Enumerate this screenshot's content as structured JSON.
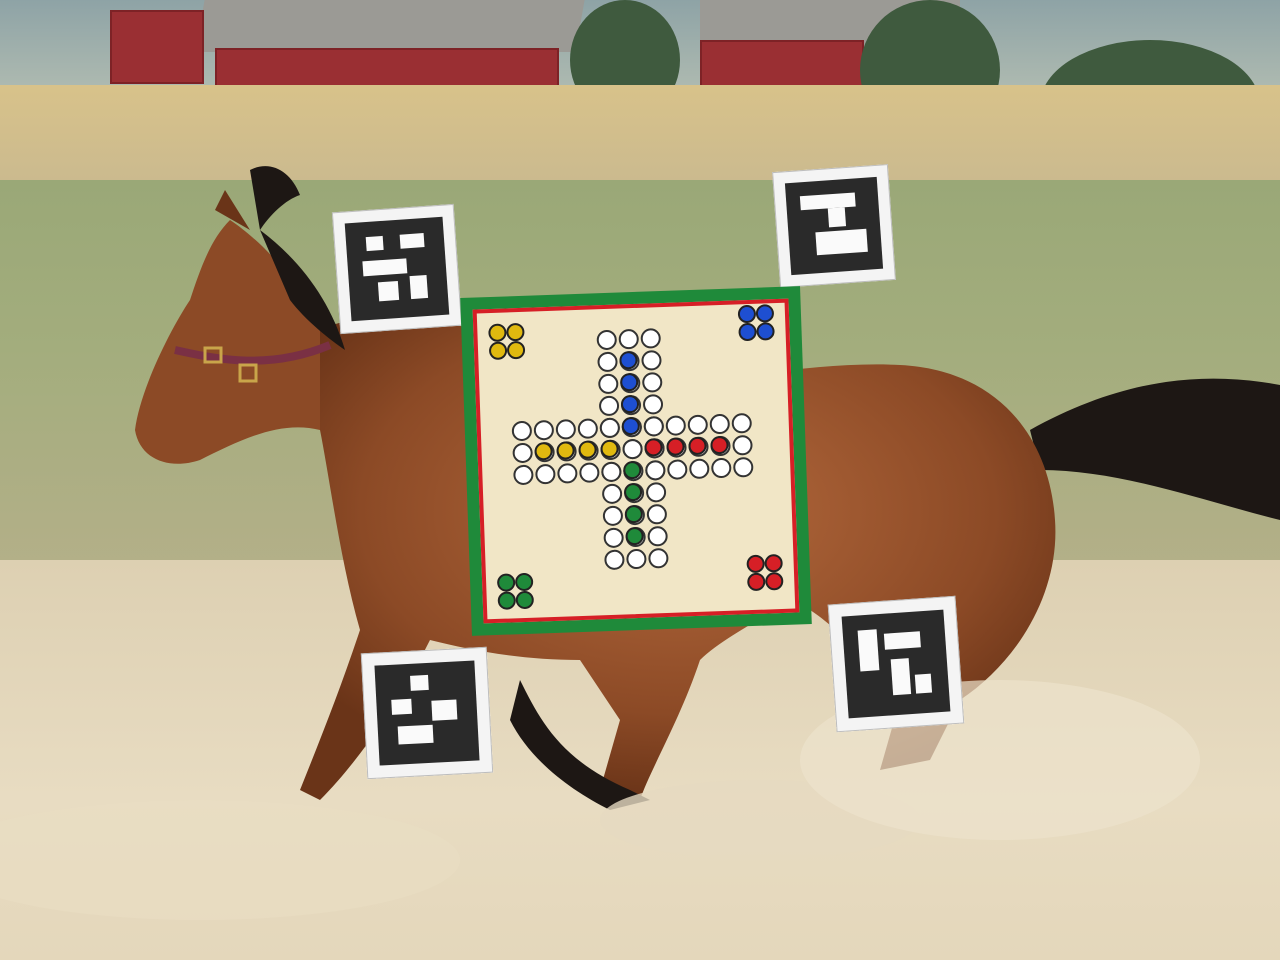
{
  "scene": {
    "description_label": "",
    "board": {
      "colors": {
        "green": "#1f8a3a",
        "red": "#d61f26",
        "yellow": "#e0b90f",
        "blue": "#1e4fd1",
        "cream": "#f1e6c6"
      }
    }
  }
}
